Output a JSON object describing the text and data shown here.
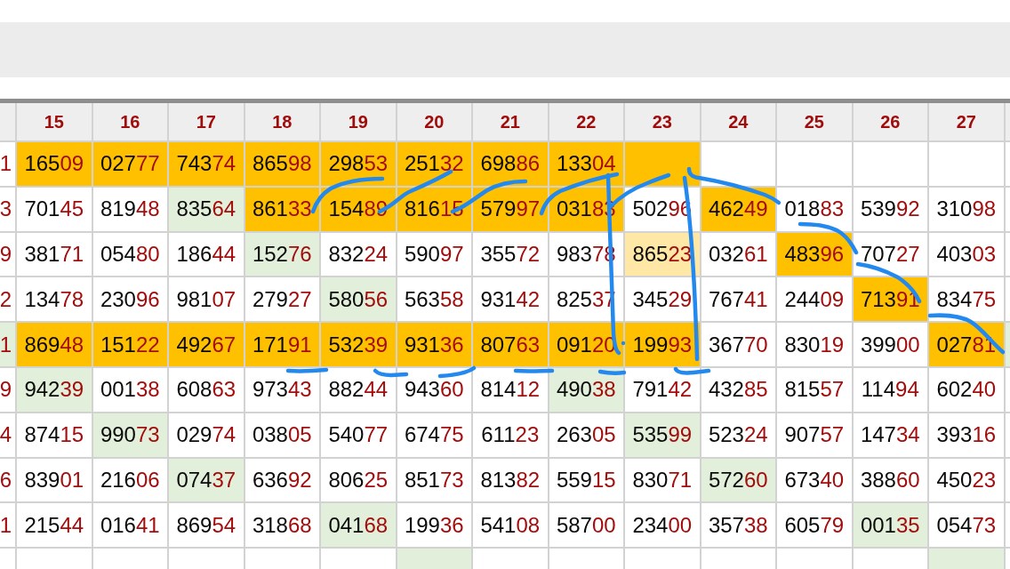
{
  "table": {
    "columns": [
      "",
      "15",
      "16",
      "17",
      "18",
      "19",
      "20",
      "21",
      "22",
      "23",
      "24",
      "25",
      "26",
      "27",
      ""
    ],
    "rows": [
      {
        "cells": [
          {
            "value": "1"
          },
          {
            "value": "16509",
            "color": "#ffc000"
          },
          {
            "value": "02777",
            "color": "#ffc000"
          },
          {
            "value": "74374",
            "color": "#ffc000"
          },
          {
            "value": "86598",
            "color": "#ffc000"
          },
          {
            "value": "29853",
            "color": "#ffc000"
          },
          {
            "value": "25132",
            "color": "#ffc000"
          },
          {
            "value": "69886",
            "color": "#ffc000"
          },
          {
            "value": "13304",
            "color": "#ffc000"
          },
          {
            "color": "#ffc000"
          },
          {},
          {},
          {},
          {},
          {}
        ]
      },
      {
        "cells": [
          {
            "value": "3"
          },
          {
            "value": "70145"
          },
          {
            "value": "81948"
          },
          {
            "value": "83564",
            "color": "#e2efda"
          },
          {
            "value": "86133",
            "color": "#ffc000"
          },
          {
            "value": "15489",
            "color": "#ffc000"
          },
          {
            "value": "81615",
            "color": "#ffc000"
          },
          {
            "value": "57997",
            "color": "#ffc000"
          },
          {
            "value": "03183",
            "color": "#ffc000"
          },
          {
            "value": "50296"
          },
          {
            "value": "46249",
            "color": "#ffc000"
          },
          {
            "value": "01883"
          },
          {
            "value": "53992"
          },
          {
            "value": "31098"
          },
          {}
        ]
      },
      {
        "cells": [
          {
            "value": "9"
          },
          {
            "value": "38171"
          },
          {
            "value": "05480"
          },
          {
            "value": "18644"
          },
          {
            "value": "15276",
            "color": "#e2efda"
          },
          {
            "value": "83224"
          },
          {
            "value": "59097"
          },
          {
            "value": "35572"
          },
          {
            "value": "98378"
          },
          {
            "value": "86523",
            "color": "#ffe7a6"
          },
          {
            "value": "03261"
          },
          {
            "value": "48396",
            "color": "#ffc000"
          },
          {
            "value": "70727"
          },
          {
            "value": "40303"
          },
          {}
        ]
      },
      {
        "cells": [
          {
            "value": "2"
          },
          {
            "value": "13478"
          },
          {
            "value": "23096"
          },
          {
            "value": "98107"
          },
          {
            "value": "27927"
          },
          {
            "value": "58056",
            "color": "#e2efda"
          },
          {
            "value": "56358"
          },
          {
            "value": "93142"
          },
          {
            "value": "82537"
          },
          {
            "value": "34529"
          },
          {
            "value": "76741"
          },
          {
            "value": "24409"
          },
          {
            "value": "71391",
            "color": "#ffc000"
          },
          {
            "value": "83475"
          },
          {}
        ]
      },
      {
        "cells": [
          {
            "value": "1",
            "color": "#e2efda"
          },
          {
            "value": "86948",
            "color": "#ffc000"
          },
          {
            "value": "15122",
            "color": "#ffc000"
          },
          {
            "value": "49267",
            "color": "#ffc000"
          },
          {
            "value": "17191",
            "color": "#ffc000"
          },
          {
            "value": "53239",
            "color": "#ffc000"
          },
          {
            "value": "93136",
            "color": "#ffc000"
          },
          {
            "value": "80763",
            "color": "#ffc000"
          },
          {
            "value": "09120",
            "color": "#ffc000"
          },
          {
            "value": "19993",
            "color": "#ffc000"
          },
          {
            "value": "36770"
          },
          {
            "value": "83019"
          },
          {
            "value": "39900"
          },
          {
            "value": "02781",
            "color": "#ffc000"
          },
          {
            "color": "#e2efda"
          }
        ]
      },
      {
        "cells": [
          {
            "value": "9"
          },
          {
            "value": "94239",
            "color": "#e2efda"
          },
          {
            "value": "00138"
          },
          {
            "value": "60863"
          },
          {
            "value": "97343"
          },
          {
            "value": "88244"
          },
          {
            "value": "94360"
          },
          {
            "value": "81412"
          },
          {
            "value": "49038",
            "color": "#e2efda"
          },
          {
            "value": "79142"
          },
          {
            "value": "43285"
          },
          {
            "value": "81557"
          },
          {
            "value": "11494"
          },
          {
            "value": "60240"
          },
          {}
        ]
      },
      {
        "cells": [
          {
            "value": "4"
          },
          {
            "value": "87415"
          },
          {
            "value": "99073",
            "color": "#e2efda"
          },
          {
            "value": "02974"
          },
          {
            "value": "03805"
          },
          {
            "value": "54077"
          },
          {
            "value": "67475"
          },
          {
            "value": "61123"
          },
          {
            "value": "26305"
          },
          {
            "value": "53599",
            "color": "#e2efda"
          },
          {
            "value": "52324"
          },
          {
            "value": "90757"
          },
          {
            "value": "14734"
          },
          {
            "value": "39316"
          },
          {}
        ]
      },
      {
        "cells": [
          {
            "value": "6"
          },
          {
            "value": "83901"
          },
          {
            "value": "21606"
          },
          {
            "value": "07437",
            "color": "#e2efda"
          },
          {
            "value": "63692"
          },
          {
            "value": "80625"
          },
          {
            "value": "85173"
          },
          {
            "value": "81382"
          },
          {
            "value": "55915"
          },
          {
            "value": "83071"
          },
          {
            "value": "57260",
            "color": "#e2efda"
          },
          {
            "value": "67340"
          },
          {
            "value": "38860"
          },
          {
            "value": "45023"
          },
          {}
        ]
      },
      {
        "cells": [
          {
            "value": "1"
          },
          {
            "value": "21544"
          },
          {
            "value": "01641"
          },
          {
            "value": "86954"
          },
          {
            "value": "31868"
          },
          {
            "value": "04168",
            "color": "#e2efda"
          },
          {
            "value": "19936"
          },
          {
            "value": "54108"
          },
          {
            "value": "58700"
          },
          {
            "value": "23400"
          },
          {
            "value": "35738"
          },
          {
            "value": "60579"
          },
          {
            "value": "00135",
            "color": "#e2efda"
          },
          {
            "value": "05473"
          },
          {}
        ]
      },
      {
        "cells": [
          {},
          {},
          {},
          {},
          {},
          {},
          {
            "color": "#e2efda"
          },
          {},
          {},
          {},
          {},
          {},
          {},
          {
            "color": "#e2efda"
          },
          {}
        ]
      }
    ]
  }
}
